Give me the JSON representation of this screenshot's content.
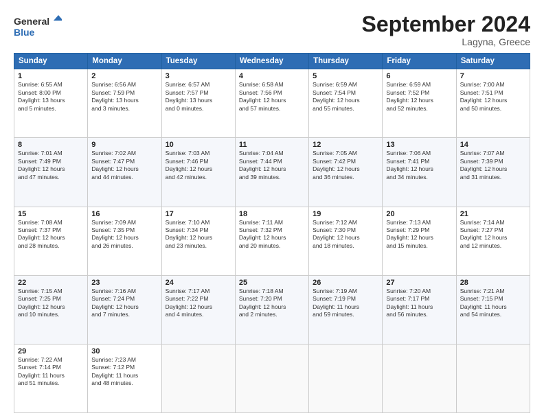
{
  "logo": {
    "line1": "General",
    "line2": "Blue"
  },
  "title": "September 2024",
  "location": "Lagyna, Greece",
  "days_of_week": [
    "Sunday",
    "Monday",
    "Tuesday",
    "Wednesday",
    "Thursday",
    "Friday",
    "Saturday"
  ],
  "weeks": [
    [
      {
        "day": "1",
        "info": "Sunrise: 6:55 AM\nSunset: 8:00 PM\nDaylight: 13 hours\nand 5 minutes."
      },
      {
        "day": "2",
        "info": "Sunrise: 6:56 AM\nSunset: 7:59 PM\nDaylight: 13 hours\nand 3 minutes."
      },
      {
        "day": "3",
        "info": "Sunrise: 6:57 AM\nSunset: 7:57 PM\nDaylight: 13 hours\nand 0 minutes."
      },
      {
        "day": "4",
        "info": "Sunrise: 6:58 AM\nSunset: 7:56 PM\nDaylight: 12 hours\nand 57 minutes."
      },
      {
        "day": "5",
        "info": "Sunrise: 6:59 AM\nSunset: 7:54 PM\nDaylight: 12 hours\nand 55 minutes."
      },
      {
        "day": "6",
        "info": "Sunrise: 6:59 AM\nSunset: 7:52 PM\nDaylight: 12 hours\nand 52 minutes."
      },
      {
        "day": "7",
        "info": "Sunrise: 7:00 AM\nSunset: 7:51 PM\nDaylight: 12 hours\nand 50 minutes."
      }
    ],
    [
      {
        "day": "8",
        "info": "Sunrise: 7:01 AM\nSunset: 7:49 PM\nDaylight: 12 hours\nand 47 minutes."
      },
      {
        "day": "9",
        "info": "Sunrise: 7:02 AM\nSunset: 7:47 PM\nDaylight: 12 hours\nand 44 minutes."
      },
      {
        "day": "10",
        "info": "Sunrise: 7:03 AM\nSunset: 7:46 PM\nDaylight: 12 hours\nand 42 minutes."
      },
      {
        "day": "11",
        "info": "Sunrise: 7:04 AM\nSunset: 7:44 PM\nDaylight: 12 hours\nand 39 minutes."
      },
      {
        "day": "12",
        "info": "Sunrise: 7:05 AM\nSunset: 7:42 PM\nDaylight: 12 hours\nand 36 minutes."
      },
      {
        "day": "13",
        "info": "Sunrise: 7:06 AM\nSunset: 7:41 PM\nDaylight: 12 hours\nand 34 minutes."
      },
      {
        "day": "14",
        "info": "Sunrise: 7:07 AM\nSunset: 7:39 PM\nDaylight: 12 hours\nand 31 minutes."
      }
    ],
    [
      {
        "day": "15",
        "info": "Sunrise: 7:08 AM\nSunset: 7:37 PM\nDaylight: 12 hours\nand 28 minutes."
      },
      {
        "day": "16",
        "info": "Sunrise: 7:09 AM\nSunset: 7:35 PM\nDaylight: 12 hours\nand 26 minutes."
      },
      {
        "day": "17",
        "info": "Sunrise: 7:10 AM\nSunset: 7:34 PM\nDaylight: 12 hours\nand 23 minutes."
      },
      {
        "day": "18",
        "info": "Sunrise: 7:11 AM\nSunset: 7:32 PM\nDaylight: 12 hours\nand 20 minutes."
      },
      {
        "day": "19",
        "info": "Sunrise: 7:12 AM\nSunset: 7:30 PM\nDaylight: 12 hours\nand 18 minutes."
      },
      {
        "day": "20",
        "info": "Sunrise: 7:13 AM\nSunset: 7:29 PM\nDaylight: 12 hours\nand 15 minutes."
      },
      {
        "day": "21",
        "info": "Sunrise: 7:14 AM\nSunset: 7:27 PM\nDaylight: 12 hours\nand 12 minutes."
      }
    ],
    [
      {
        "day": "22",
        "info": "Sunrise: 7:15 AM\nSunset: 7:25 PM\nDaylight: 12 hours\nand 10 minutes."
      },
      {
        "day": "23",
        "info": "Sunrise: 7:16 AM\nSunset: 7:24 PM\nDaylight: 12 hours\nand 7 minutes."
      },
      {
        "day": "24",
        "info": "Sunrise: 7:17 AM\nSunset: 7:22 PM\nDaylight: 12 hours\nand 4 minutes."
      },
      {
        "day": "25",
        "info": "Sunrise: 7:18 AM\nSunset: 7:20 PM\nDaylight: 12 hours\nand 2 minutes."
      },
      {
        "day": "26",
        "info": "Sunrise: 7:19 AM\nSunset: 7:19 PM\nDaylight: 11 hours\nand 59 minutes."
      },
      {
        "day": "27",
        "info": "Sunrise: 7:20 AM\nSunset: 7:17 PM\nDaylight: 11 hours\nand 56 minutes."
      },
      {
        "day": "28",
        "info": "Sunrise: 7:21 AM\nSunset: 7:15 PM\nDaylight: 11 hours\nand 54 minutes."
      }
    ],
    [
      {
        "day": "29",
        "info": "Sunrise: 7:22 AM\nSunset: 7:14 PM\nDaylight: 11 hours\nand 51 minutes."
      },
      {
        "day": "30",
        "info": "Sunrise: 7:23 AM\nSunset: 7:12 PM\nDaylight: 11 hours\nand 48 minutes."
      },
      null,
      null,
      null,
      null,
      null
    ]
  ]
}
